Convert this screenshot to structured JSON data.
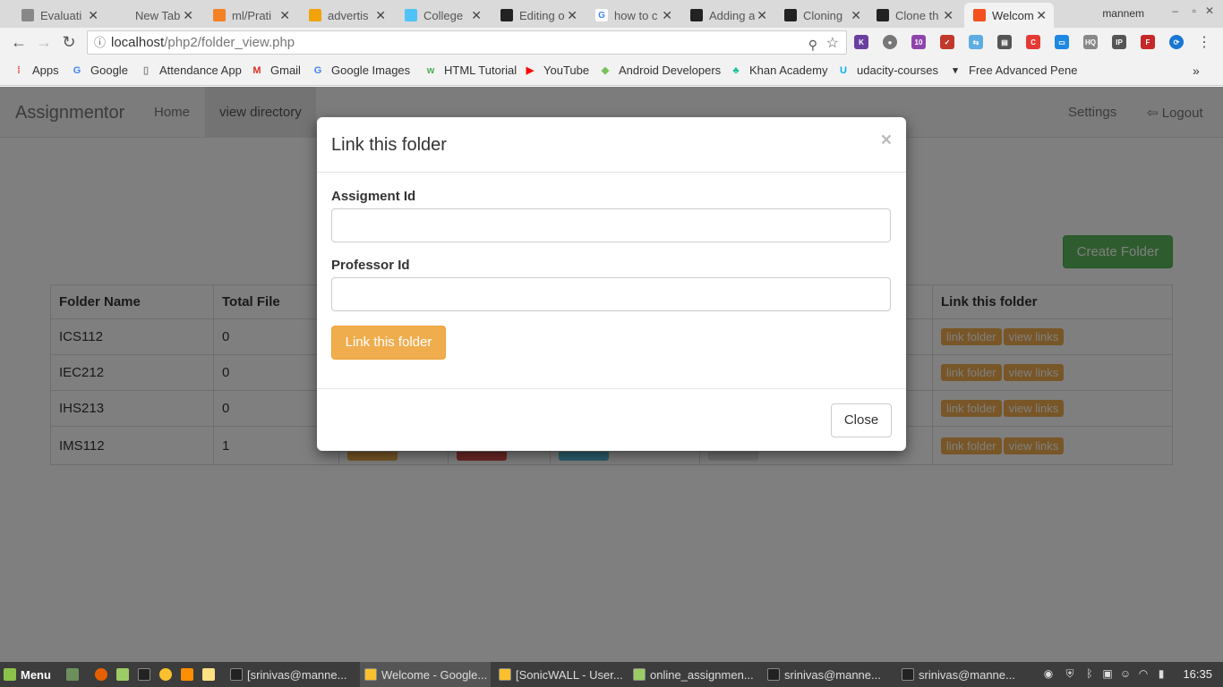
{
  "browser": {
    "tabs": [
      {
        "title": "Evaluati",
        "color": "#888",
        "glyph": "",
        "active": false
      },
      {
        "title": "New Tab",
        "color": "transparent",
        "glyph": "",
        "active": false
      },
      {
        "title": "ml/Prati",
        "color": "#f58025",
        "glyph": "",
        "active": false
      },
      {
        "title": "advertis",
        "color": "#f0a30a",
        "glyph": "",
        "active": false
      },
      {
        "title": "College",
        "color": "#4fc3f7",
        "glyph": "",
        "active": false
      },
      {
        "title": "Editing o",
        "color": "#222",
        "glyph": "",
        "active": false
      },
      {
        "title": "how to c",
        "color": "#fff",
        "glyph": "G",
        "active": false
      },
      {
        "title": "Adding a",
        "color": "#222",
        "glyph": "",
        "active": false
      },
      {
        "title": "Cloning",
        "color": "#222",
        "glyph": "",
        "active": false
      },
      {
        "title": "Clone th",
        "color": "#222",
        "glyph": "",
        "active": false
      },
      {
        "title": "Welcom",
        "color": "#f4511e",
        "glyph": "",
        "active": true
      }
    ],
    "profile": "mannem",
    "url_host": "localhost",
    "url_path": "/php2/folder_view.php",
    "bookmarks": [
      {
        "label": "Apps",
        "icon": "apps-icon"
      },
      {
        "label": "Google",
        "icon": "google-icon"
      },
      {
        "label": "Attendance App",
        "icon": "page-icon"
      },
      {
        "label": "Gmail",
        "icon": "gmail-icon"
      },
      {
        "label": "Google Images",
        "icon": "google-icon"
      },
      {
        "label": "HTML Tutorial",
        "icon": "w3-icon"
      },
      {
        "label": "YouTube",
        "icon": "youtube-icon"
      },
      {
        "label": "Android Developers",
        "icon": "android-icon"
      },
      {
        "label": "Khan Academy",
        "icon": "khan-icon"
      },
      {
        "label": "udacity-courses",
        "icon": "udacity-icon"
      },
      {
        "label": "Free Advanced Pene",
        "icon": "bookmark-icon"
      }
    ],
    "more_bookmarks": "»"
  },
  "app": {
    "brand": "Assignmentor",
    "nav": {
      "home": "Home",
      "view_directory": "view directory",
      "settings": "Settings",
      "logout": "Logout"
    },
    "create_folder": "Create Folder",
    "table": {
      "headers": {
        "folder_name": "Folder Name",
        "total_file": "Total File",
        "link_this_folder": "Link this folder"
      },
      "rows": [
        {
          "name": "ICS112",
          "total": "0"
        },
        {
          "name": "IEC212",
          "total": "0"
        },
        {
          "name": "IHS213",
          "total": "0"
        },
        {
          "name": "IMS112",
          "total": "1"
        }
      ],
      "link_folder_label": "link folder",
      "view_links_label": "view links"
    }
  },
  "modal": {
    "title": "Link this folder",
    "close_x": "×",
    "assignment_label": "Assigment Id",
    "assignment_value": "",
    "professor_label": "Professor Id",
    "professor_value": "",
    "submit_label": "Link this folder",
    "close_label": "Close"
  },
  "taskbar": {
    "menu_label": "Menu",
    "windows": [
      {
        "label": "[srinivas@manne...",
        "active": false
      },
      {
        "label": "Welcome - Google...",
        "active": true
      },
      {
        "label": "[SonicWALL - User...",
        "active": false
      },
      {
        "label": "online_assignmen...",
        "active": false
      },
      {
        "label": "srinivas@manne...",
        "active": false
      },
      {
        "label": "srinivas@manne...",
        "active": false
      }
    ],
    "clock": "16:35"
  }
}
